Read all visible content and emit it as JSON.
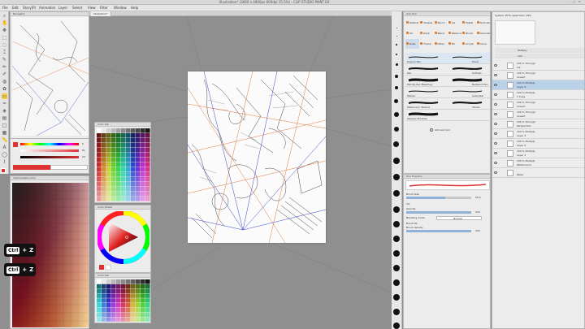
{
  "window": {
    "title": "Illustration* (3600 x 4800px 600dpi 15.5%) - CLIP STUDIO PAINT EX"
  },
  "menu": {
    "items": [
      "File",
      "Edit",
      "Story(P)",
      "Animation",
      "Layer",
      "Select",
      "View",
      "Filter",
      "Window",
      "Help"
    ]
  },
  "navigator": {
    "title": "Navigator",
    "zoom": "15.5",
    "angle": "0.0"
  },
  "color_sliders": {
    "values": [
      "0",
      "61",
      "43"
    ]
  },
  "color_history": {
    "title": "Intermediate Color"
  },
  "swatch_panel": {
    "title": "Color Set"
  },
  "color_wheel": {
    "title": "Color Wheel"
  },
  "color_set2": {
    "title": "Color Set"
  },
  "canvas": {
    "tab_label": "Illustration*"
  },
  "sub_tool": {
    "title": "Sub Tool",
    "tools": [
      {
        "label": "Default"
      },
      {
        "label": "Shapes"
      },
      {
        "label": "Pencil"
      },
      {
        "label": "Ink"
      },
      {
        "label": "Pastel"
      },
      {
        "label": "Airbrush"
      },
      {
        "label": "Oil"
      },
      {
        "label": "Paint"
      },
      {
        "label": "Blend"
      },
      {
        "label": "Watercolor"
      },
      {
        "label": "Brush"
      },
      {
        "label": "Decoration"
      },
      {
        "label": "Ruler"
      },
      {
        "label": "Frame"
      },
      {
        "label": "Other"
      },
      {
        "label": "Fill"
      },
      {
        "label": "Acrylic"
      },
      {
        "label": "Cloud"
      }
    ],
    "brushes": [
      {
        "name": "Crayon Pen",
        "alt": "Fixed"
      },
      {
        "name": "Pen",
        "alt": "Unfixed"
      },
      {
        "name": "Felt-tip Pen Bleeding",
        "alt": "Ballpoint Pen"
      },
      {
        "name": "Marker",
        "alt": "Autoclear"
      },
      {
        "name": "Watercolor Texture",
        "alt": "Stroke"
      },
      {
        "name": "Opaque Brushes",
        "alt": ""
      }
    ],
    "add_button": "Add sub tool"
  },
  "tool_property": {
    "title": "Tool Property",
    "brush_size_label": "Brush Size",
    "brush_size_value": "60.0",
    "ink_label": "Ink",
    "opacity_label": "Opacity",
    "opacity_value": "100",
    "blending_label": "Blending mode",
    "blending_value": "Normal",
    "brush_tip_label": "Brush tip",
    "brush_density_label": "Brush density",
    "brush_density_value": "100"
  },
  "layer_panel": {
    "header_info": "System 4576 Application 18%",
    "blend_mode": "Multiply",
    "opacity": "100",
    "layers": [
      {
        "mode": "100 % Through",
        "name": "Ink"
      },
      {
        "mode": "100 % Through",
        "name": "Lineart"
      },
      {
        "mode": "100 % Multiply",
        "name": "Layer 4"
      },
      {
        "mode": "100 % Multiply",
        "name": "T Copy"
      },
      {
        "mode": "100 % Through",
        "name": "Lineart"
      },
      {
        "mode": "100 % Through",
        "name": "Lineart"
      },
      {
        "mode": "100 % Through",
        "name": "Perspective"
      },
      {
        "mode": "100 % Multiply",
        "name": "Layer 3"
      },
      {
        "mode": "100 % Multiply",
        "name": "Layer 2"
      },
      {
        "mode": "100 % Multiply",
        "name": "Layer 1"
      },
      {
        "mode": "100 % Multiply",
        "name": "Watercolors"
      },
      {
        "mode": "",
        "name": "Paper"
      }
    ]
  },
  "shortcuts": [
    {
      "key": "Ctrl",
      "plus": "+",
      "letter": "Z"
    },
    {
      "key": "Ctrl",
      "plus": "+",
      "letter": "Z"
    }
  ]
}
